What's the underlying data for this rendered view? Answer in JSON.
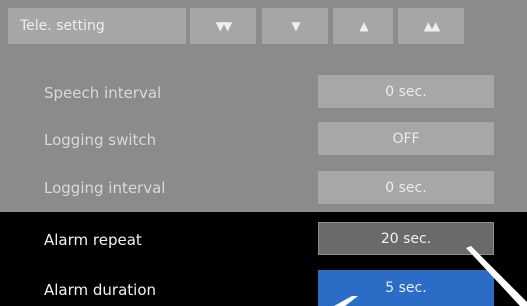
{
  "header": {
    "tab_label": "Tele. setting",
    "nav": {
      "double_down": "▼▼",
      "down": "▼",
      "up": "▲",
      "double_up": "▲▲"
    }
  },
  "settings": [
    {
      "label": "Speech interval",
      "value": "0 sec."
    },
    {
      "label": "Logging switch",
      "value": "OFF"
    },
    {
      "label": "Logging interval",
      "value": "0 sec."
    },
    {
      "label": "Alarm repeat",
      "value": "20 sec."
    },
    {
      "label": "Alarm duration",
      "value": "5 sec."
    }
  ],
  "colors": {
    "panel_gray": "#8b8b8b",
    "button_gray": "#a6a6a6",
    "highlight_dark": "#000000",
    "selected_blue": "#2b6dc6"
  }
}
